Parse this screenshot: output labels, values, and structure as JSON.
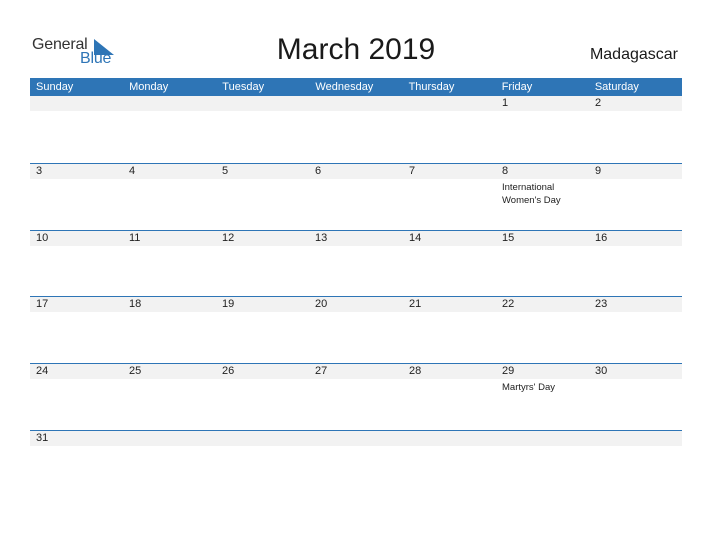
{
  "header": {
    "logo_general": "General",
    "logo_blue": "Blue",
    "title": "March 2019",
    "country": "Madagascar"
  },
  "colors": {
    "accent": "#2e75b6",
    "strip": "#f2f2f2"
  },
  "weekdays": [
    "Sunday",
    "Monday",
    "Tuesday",
    "Wednesday",
    "Thursday",
    "Friday",
    "Saturday"
  ],
  "weeks": [
    {
      "days": [
        "",
        "",
        "",
        "",
        "",
        "1",
        "2"
      ],
      "events": [
        "",
        "",
        "",
        "",
        "",
        "",
        ""
      ]
    },
    {
      "days": [
        "3",
        "4",
        "5",
        "6",
        "7",
        "8",
        "9"
      ],
      "events": [
        "",
        "",
        "",
        "",
        "",
        "International Women's Day",
        ""
      ]
    },
    {
      "days": [
        "10",
        "11",
        "12",
        "13",
        "14",
        "15",
        "16"
      ],
      "events": [
        "",
        "",
        "",
        "",
        "",
        "",
        ""
      ]
    },
    {
      "days": [
        "17",
        "18",
        "19",
        "20",
        "21",
        "22",
        "23"
      ],
      "events": [
        "",
        "",
        "",
        "",
        "",
        "",
        ""
      ]
    },
    {
      "days": [
        "24",
        "25",
        "26",
        "27",
        "28",
        "29",
        "30"
      ],
      "events": [
        "",
        "",
        "",
        "",
        "",
        "Martyrs' Day",
        ""
      ]
    },
    {
      "days": [
        "31",
        "",
        "",
        "",
        "",
        "",
        ""
      ],
      "events": [
        "",
        "",
        "",
        "",
        "",
        "",
        ""
      ]
    }
  ]
}
